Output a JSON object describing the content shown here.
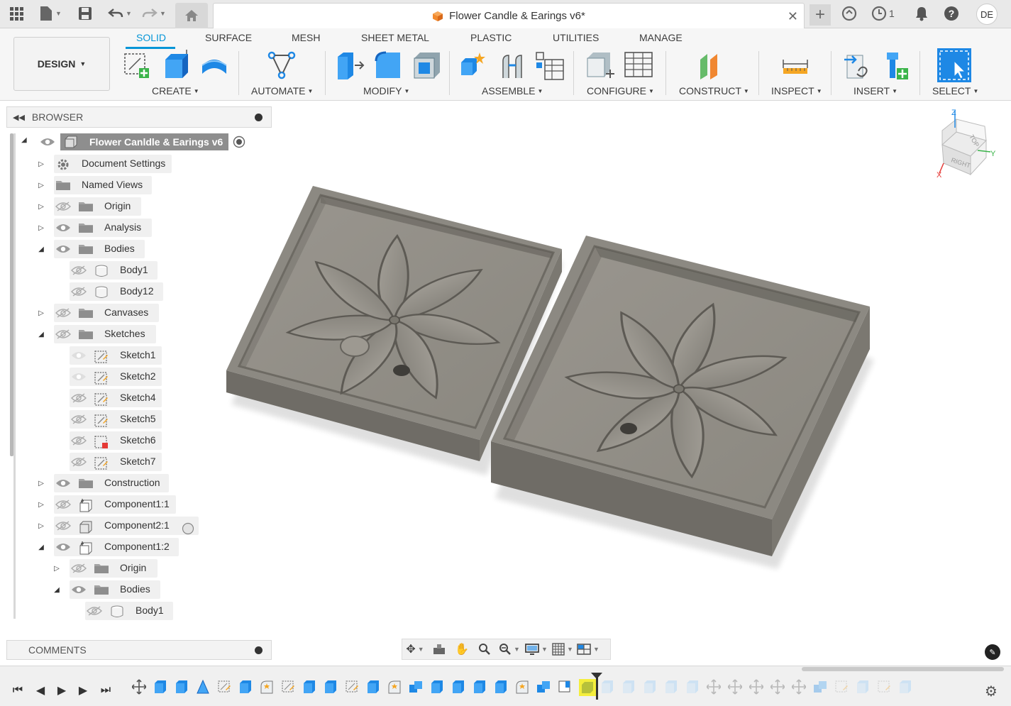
{
  "app": {
    "document_title": "Flower Candle & Earings v6*",
    "job_count": "1",
    "user_initials": "DE"
  },
  "ribbon": {
    "workspace": "DESIGN",
    "tabs": [
      "SOLID",
      "SURFACE",
      "MESH",
      "SHEET METAL",
      "PLASTIC",
      "UTILITIES",
      "MANAGE"
    ],
    "active_tab": "SOLID",
    "groups": [
      "CREATE",
      "AUTOMATE",
      "MODIFY",
      "ASSEMBLE",
      "CONFIGURE",
      "CONSTRUCT",
      "INSPECT",
      "INSERT",
      "SELECT"
    ]
  },
  "browser": {
    "title": "BROWSER",
    "root": "Flower Canldle & Earings v6",
    "items": [
      {
        "label": "Document Settings"
      },
      {
        "label": "Named Views"
      },
      {
        "label": "Origin"
      },
      {
        "label": "Analysis"
      },
      {
        "label": "Bodies"
      },
      {
        "label": "Body1"
      },
      {
        "label": "Body12"
      },
      {
        "label": "Canvases"
      },
      {
        "label": "Sketches"
      },
      {
        "label": "Sketch1"
      },
      {
        "label": "Sketch2"
      },
      {
        "label": "Sketch4"
      },
      {
        "label": "Sketch5"
      },
      {
        "label": "Sketch6"
      },
      {
        "label": "Sketch7"
      },
      {
        "label": "Construction"
      },
      {
        "label": "Component1:1"
      },
      {
        "label": "Component2:1"
      },
      {
        "label": "Component1:2"
      },
      {
        "label": "Origin"
      },
      {
        "label": "Bodies"
      },
      {
        "label": "Body1"
      }
    ]
  },
  "comments": {
    "title": "COMMENTS"
  },
  "viewcube": {
    "top": "TOP",
    "right": "RIGHT",
    "axis_x": "X",
    "axis_y": "Y",
    "axis_z": "Z"
  },
  "colors": {
    "accent": "#0696d7",
    "model": "#8a877f",
    "timeline_highlight": "#f4ee3c"
  }
}
